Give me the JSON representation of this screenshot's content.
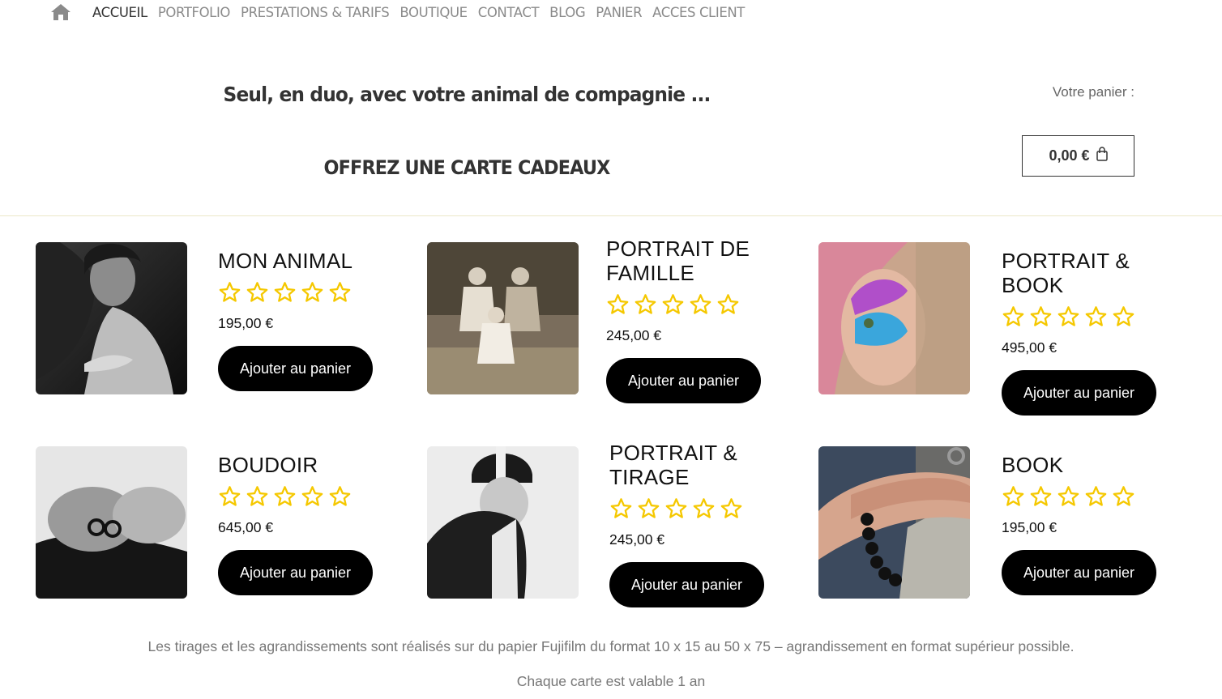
{
  "nav": {
    "items": [
      "ACCUEIL",
      "PORTFOLIO",
      "PRESTATIONS & TARIFS",
      "BOUTIQUE",
      "CONTACT",
      "BLOG",
      "PANIER",
      "ACCES CLIENT"
    ],
    "active": "ACCUEIL"
  },
  "header": {
    "tagline": "Seul, en duo, avec votre animal de compagnie ...",
    "gift_title": "OFFREZ UNE CARTE CADEAUX",
    "cart_label": "Votre panier :",
    "cart_total": "0,00 €"
  },
  "products": [
    {
      "title": "MON ANIMAL",
      "price": "195,00 €",
      "button": "Ajouter au panier",
      "rating": 0,
      "image": "woman-with-animal-photo"
    },
    {
      "title": "PORTRAIT DE FAMILLE",
      "price": "245,00 €",
      "button": "Ajouter au panier",
      "rating": 0,
      "image": "family-portrait-photo"
    },
    {
      "title": "PORTRAIT & BOOK",
      "price": "495,00 €",
      "button": "Ajouter au panier",
      "rating": 0,
      "image": "painted-face-portrait-photo"
    },
    {
      "title": "BOUDOIR",
      "price": "645,00 €",
      "button": "Ajouter au panier",
      "rating": 0,
      "image": "boudoir-photo"
    },
    {
      "title": "PORTRAIT & TIRAGE",
      "price": "245,00 €",
      "button": "Ajouter au panier",
      "rating": 0,
      "image": "rider-with-horse-photo"
    },
    {
      "title": "BOOK",
      "price": "195,00 €",
      "button": "Ajouter au panier",
      "rating": 0,
      "image": "hands-bracelet-photo"
    }
  ],
  "footnote": "Les tirages et les agrandissements sont réalisés sur du papier Fujifilm du format 10 x 15 au 50 x 75 – agrandissement en format supérieur possible.",
  "validity": "Chaque carte est valable 1 an",
  "colors": {
    "star": "#f5c800",
    "button_bg": "#000000",
    "nav_active": "#333333",
    "nav_inactive": "#8a8a8a"
  }
}
